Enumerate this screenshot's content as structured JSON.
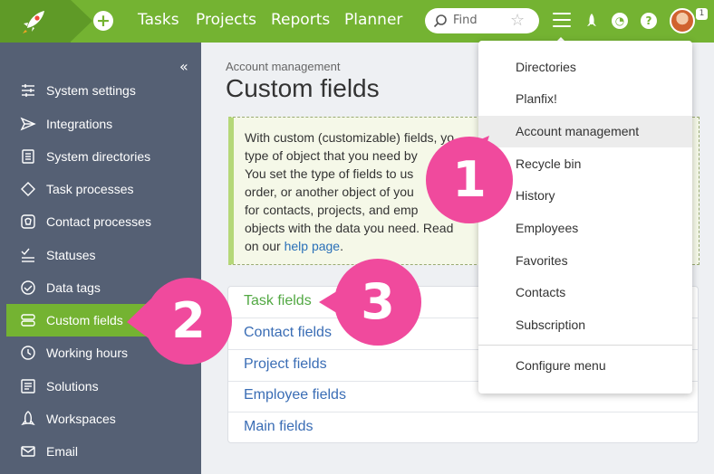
{
  "topbar": {
    "nav": [
      "Tasks",
      "Projects",
      "Reports",
      "Planner"
    ],
    "search_placeholder": "Find",
    "notification_badge": "1",
    "colors": {
      "brand": "#74b332",
      "brand_dark": "#5f9a27"
    }
  },
  "sidebar": {
    "items": [
      {
        "label": "System settings",
        "icon": "sliders-icon"
      },
      {
        "label": "Integrations",
        "icon": "paper-plane-icon"
      },
      {
        "label": "System directories",
        "icon": "list-icon"
      },
      {
        "label": "Task processes",
        "icon": "diamond-icon"
      },
      {
        "label": "Contact processes",
        "icon": "contact-card-icon"
      },
      {
        "label": "Statuses",
        "icon": "checklist-icon"
      },
      {
        "label": "Data tags",
        "icon": "tag-icon"
      },
      {
        "label": "Custom fields",
        "icon": "fields-icon",
        "active": true
      },
      {
        "label": "Working hours",
        "icon": "clock-icon"
      },
      {
        "label": "Solutions",
        "icon": "solutions-icon"
      },
      {
        "label": "Workspaces",
        "icon": "rocket-icon"
      },
      {
        "label": "Email",
        "icon": "mail-icon"
      }
    ]
  },
  "main": {
    "breadcrumb": "Account management",
    "title": "Custom fields",
    "info_lines": [
      "With custom (customizable) fields, yo",
      "type of object that you need by",
      "You set the type of fields to us",
      "order, or another object of you",
      "for contacts, projects, and emp",
      "objects with the data you need. Read"
    ],
    "info_last_prefix": "on our ",
    "info_link": "help page",
    "info_last_suffix": ".",
    "field_links": [
      "Task fields",
      "Contact fields",
      "Project fields",
      "Employee fields",
      "Main fields"
    ]
  },
  "menu": {
    "items": [
      "Directories",
      "Planfix!",
      "Account management",
      "Recycle bin",
      "History",
      "Employees",
      "Favorites",
      "Contacts",
      "Subscription"
    ],
    "highlighted": "Account management",
    "footer": "Configure menu"
  },
  "callouts": [
    "1",
    "2",
    "3"
  ],
  "callout_color": "#f04a9d"
}
